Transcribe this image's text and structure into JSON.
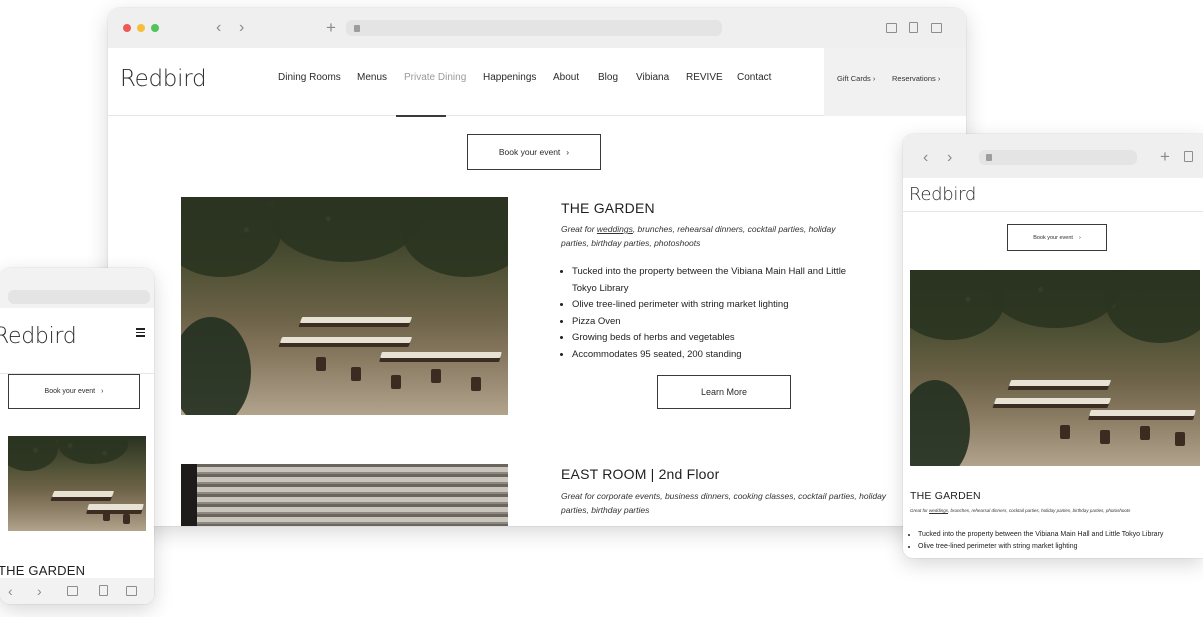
{
  "desktop": {
    "nav": {
      "logo": "Redbird",
      "links": [
        "Dining Rooms",
        "Menus",
        "Private Dining",
        "Happenings",
        "About",
        "Blog",
        "Vibiana",
        "REVIVE",
        "Contact"
      ],
      "active_link": "Private Dining",
      "gift_cards": "Gift Cards",
      "reservations": "Reservations"
    },
    "book_event": "Book your event",
    "garden": {
      "title": "THE GARDEN",
      "intro_prefix": "Great for ",
      "intro_link": "weddings",
      "intro_rest": ", brunches, rehearsal dinners, cocktail parties, holiday parties, birthday parties, photoshoots",
      "bullets": [
        "Tucked into the property between the Vibiana Main Hall and Little Tokyo Library",
        "Olive tree-lined perimeter with string market lighting",
        "Pizza Oven",
        "Growing beds of herbs and vegetables",
        "Accommodates 95 seated, 200 standing"
      ],
      "learn_more": "Learn More"
    },
    "east_room": {
      "title": "EAST ROOM | 2nd Floor",
      "intro": "Great for corporate events, business dinners, cooking classes, cocktail parties, holiday parties, birthday parties"
    }
  },
  "mobile": {
    "logo": "Redbird",
    "book_event": "Book your event",
    "section_title": "THE GARDEN"
  },
  "tablet": {
    "logo": "Redbird",
    "book_event": "Book your event",
    "section_title": "THE GARDEN",
    "intro_prefix": "Great for ",
    "intro_link": "weddings",
    "intro_rest": ", brunches, rehearsal dinners, cocktail parties, holiday parties, birthday parties, photoshoots",
    "bullets": [
      "Tucked into the property between the Vibiana Main Hall and Little Tokyo Library",
      "Olive tree-lined perimeter with string market lighting"
    ]
  },
  "colors": {
    "traffic_red": "#ee5b57",
    "traffic_yellow": "#f6be3b",
    "traffic_green": "#52c25a"
  }
}
